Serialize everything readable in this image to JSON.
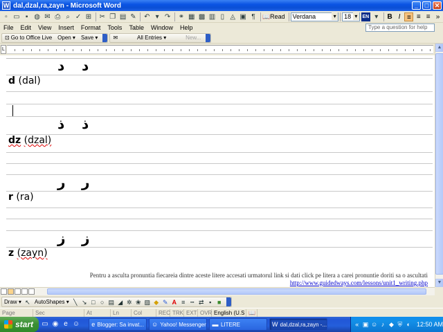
{
  "window": {
    "title": "dal,dzal,ra,zayn - Microsoft Word"
  },
  "toolbar": {
    "read_label": "Read",
    "font_name": "Verdana",
    "font_size": "18",
    "language_badge": "EN",
    "bold_label": "B",
    "italic_label": "I"
  },
  "menu": {
    "items": [
      "File",
      "Edit",
      "View",
      "Insert",
      "Format",
      "Tools",
      "Table",
      "Window",
      "Help"
    ],
    "help_placeholder": "Type a question for help"
  },
  "toolbar2": {
    "office_live": "Go to Office Live",
    "open": "Open ▾",
    "save": "Save ▾",
    "all_entries": "All Entries ▾",
    "new": "New..."
  },
  "document": {
    "letters": [
      {
        "arabic": [
          "د",
          "د"
        ],
        "latin": "d",
        "name": "(dal)"
      },
      {
        "arabic": [
          "ذ",
          "ذ"
        ],
        "latin": "dz",
        "name": "(dzal)"
      },
      {
        "arabic": [
          "ر",
          "ر"
        ],
        "latin": "r",
        "name": "(ra)"
      },
      {
        "arabic": [
          "ز",
          "ز"
        ],
        "latin": "z",
        "name": "(zayn)"
      }
    ],
    "footer_text": "Pentru a asculta pronuntia fiecareia dintre aceste litere accesati urmatorul link si dati click pe litera a carei pronuntie doriti sa o ascultati",
    "footer_link": "http://www.guidedways.com/lessons/unit1_writing.php"
  },
  "drawbar": {
    "draw_label": "Draw ▾",
    "autoshapes_label": "AutoShapes ▾"
  },
  "statusbar": {
    "page": "Page",
    "sec": "Sec",
    "at": "At",
    "ln": "Ln",
    "col": "Col",
    "rec": "REC",
    "trk": "TRK",
    "ext": "EXT",
    "ovr": "OVR",
    "language": "English (U.S"
  },
  "taskbar": {
    "start_label": "start",
    "tasks": [
      {
        "label": "Blogger: Sa invat...",
        "icon": "browser-icon",
        "active": false
      },
      {
        "label": "Yahoo! Messenger",
        "icon": "messenger-icon",
        "active": false
      },
      {
        "label": "LITERE",
        "icon": "folder-icon",
        "active": false
      },
      {
        "label": "dal,dzal,ra,zayn -...",
        "icon": "word-icon",
        "active": true
      }
    ],
    "clock": "12:50 AM"
  }
}
